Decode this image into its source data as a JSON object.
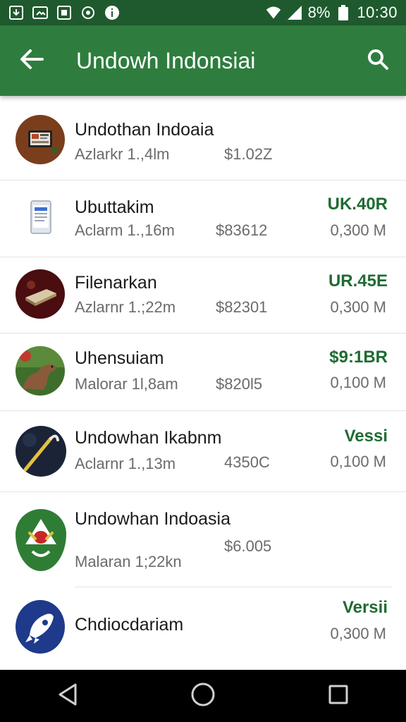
{
  "status_bar": {
    "battery": "8%",
    "time": "10:30",
    "icons": [
      "download-icon",
      "photo-icon",
      "notification-icon",
      "sync-icon",
      "info-icon",
      "wifi-icon",
      "signal-icon",
      "battery-icon"
    ]
  },
  "app_bar": {
    "title": "Undowh Indonsiai",
    "back_icon": "arrow-left-icon",
    "search_icon": "search-icon"
  },
  "list": [
    {
      "title": "Undothan Indoaia",
      "subtitle": "Azlarkr 1.,4lm",
      "price": "$1.02Z",
      "tag": "",
      "size": "",
      "icon": "tablet-photo-avatar"
    },
    {
      "title": "Ubuttakim",
      "subtitle": "Aclarm 1.,16m",
      "price": "$83612",
      "tag": "UK.40R",
      "size": "0,300 M",
      "icon": "phone-avatar"
    },
    {
      "title": "Filenarkan",
      "subtitle": "Azlarnr 1.;22m",
      "price": "$82301",
      "tag": "UR.45E",
      "size": "0,300 M",
      "icon": "device-avatar"
    },
    {
      "title": "Uhensuiam",
      "subtitle": "Malorar 1l,8am",
      "price": "$820l5",
      "tag": "$9:1BR",
      "size": "0,100 M",
      "icon": "animal-photo-avatar"
    },
    {
      "title": "Undowhan Ikabnm",
      "subtitle": "Aclarnr 1.,13m",
      "price": "4350C",
      "tag": "Vessi",
      "size": "0,100 M",
      "icon": "wand-avatar"
    },
    {
      "title": "Undowhan Indoasia",
      "subtitle": "Malaran 1;22kn",
      "price": "$6.005",
      "tag": "",
      "size": "",
      "icon": "shield-emblem-avatar"
    },
    {
      "title": "Chdiocdariam",
      "subtitle": "",
      "price": "",
      "tag": "Versii",
      "size": "0,300 M",
      "icon": "rocket-avatar"
    }
  ],
  "nav_bar": {
    "back_icon": "triangle-back-icon",
    "home_icon": "circle-home-icon",
    "recents_icon": "square-recents-icon"
  }
}
